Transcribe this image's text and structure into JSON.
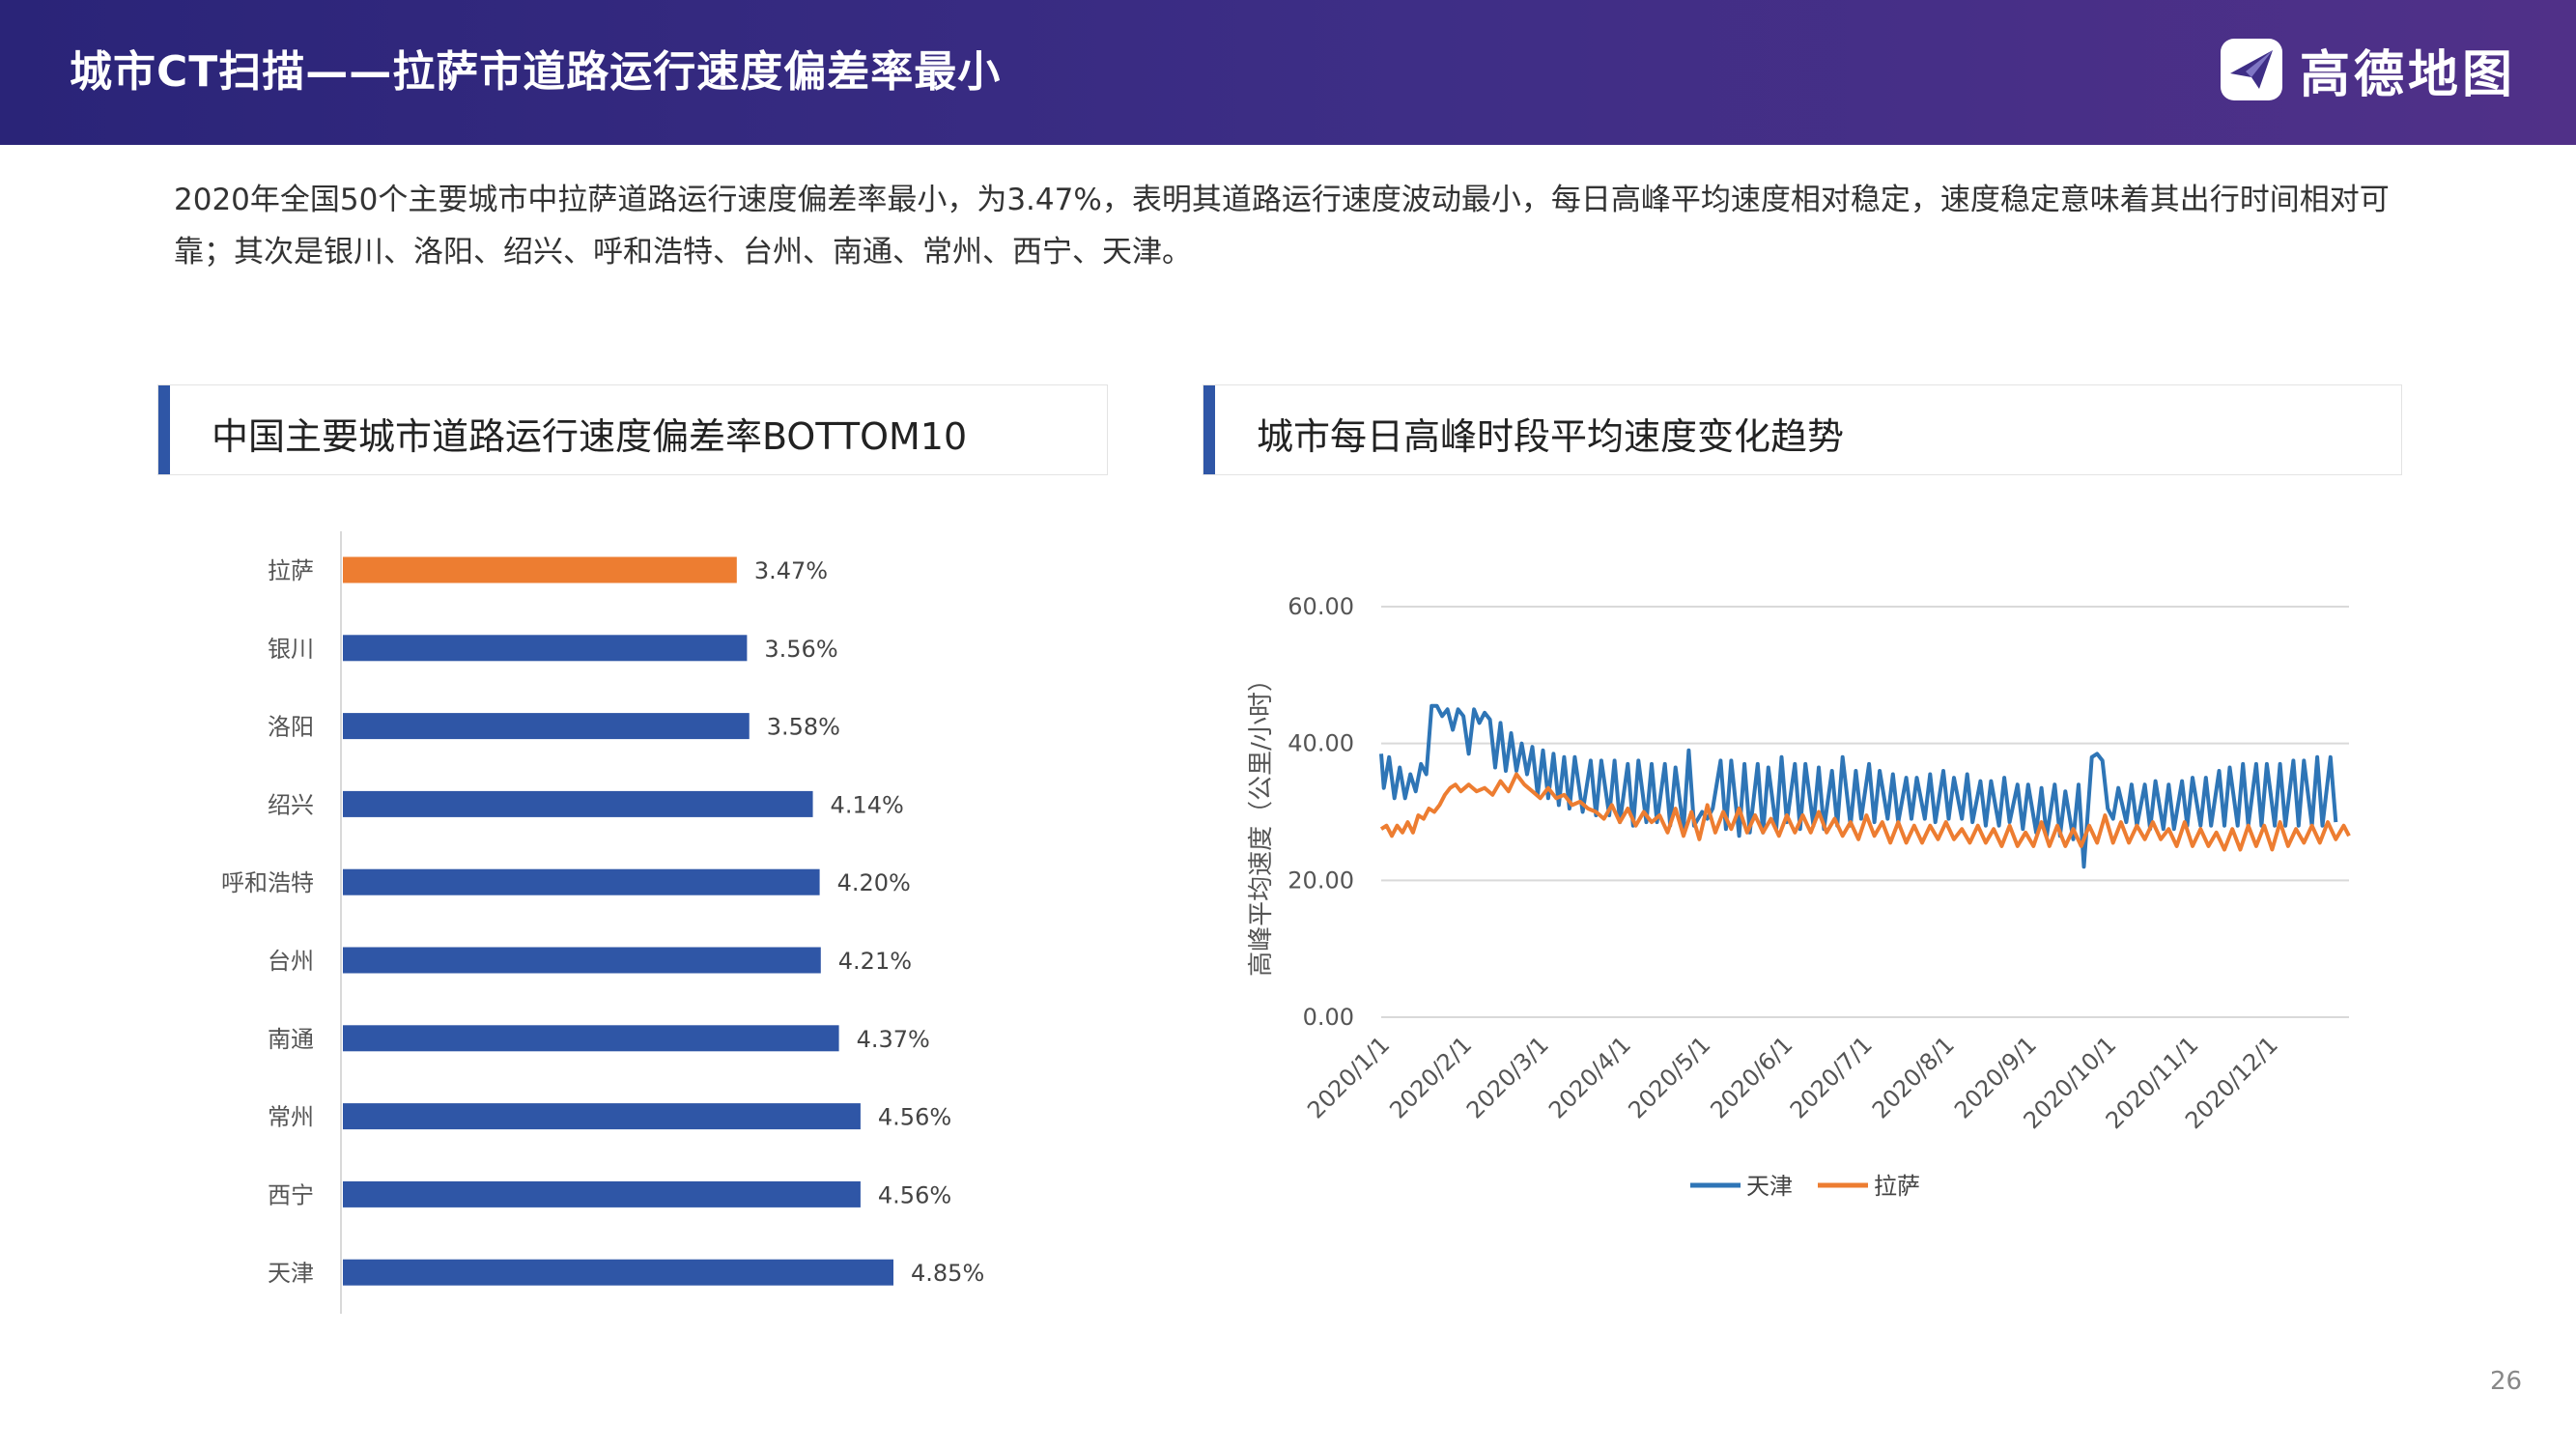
{
  "header": {
    "title": "城市CT扫描——拉萨市道路运行速度偏差率最小",
    "brand": "高德地图",
    "logo_icon": "paper-plane-logo-icon"
  },
  "intro_text": "2020年全国50个主要城市中拉萨道路运行速度偏差率最小，为3.47%，表明其道路运行速度波动最小，每日高峰平均速度相对稳定，速度稳定意味着其出行时间相对可靠；其次是银川、洛阳、绍兴、呼和浩特、台州、南通、常州、西宁、天津。",
  "left_section": {
    "title": "中国主要城市道路运行速度偏差率BOTTOM10"
  },
  "right_section": {
    "title": "城市每日高峰时段平均速度变化趋势"
  },
  "page_number": "26",
  "colors": {
    "header": "#2a2478",
    "accent_blue": "#2f56a6",
    "highlight_orange": "#ed7d31",
    "line_blue": "#2e75b6",
    "line_orange": "#ed7d31"
  },
  "chart_data": [
    {
      "type": "bar",
      "orientation": "horizontal",
      "categories": [
        "拉萨",
        "银川",
        "洛阳",
        "绍兴",
        "呼和浩特",
        "台州",
        "南通",
        "常州",
        "西宁",
        "天津"
      ],
      "values": [
        3.47,
        3.56,
        3.58,
        4.14,
        4.2,
        4.21,
        4.37,
        4.56,
        4.56,
        4.85
      ],
      "value_labels": [
        "3.47%",
        "3.56%",
        "3.58%",
        "4.14%",
        "4.20%",
        "4.21%",
        "4.37%",
        "4.56%",
        "4.56%",
        "4.85%"
      ],
      "highlight_index": 0,
      "bar_color": "#2f56a6",
      "highlight_color": "#ed7d31"
    },
    {
      "type": "line",
      "ylabel": "高峰平均速度（公里/小时）",
      "ylim": [
        0,
        60
      ],
      "yticks": [
        "0.00",
        "20.00",
        "40.00",
        "60.00"
      ],
      "xlim": [
        "2020-01-01",
        "2020-12-31"
      ],
      "xticks": [
        "2020/1/1",
        "2020/2/1",
        "2020/3/1",
        "2020/4/1",
        "2020/5/1",
        "2020/6/1",
        "2020/7/1",
        "2020/8/1",
        "2020/9/1",
        "2020/10/1",
        "2020/11/1",
        "2020/12/1"
      ],
      "grid": true,
      "legend_position": "bottom",
      "series": [
        {
          "name": "天津",
          "color": "#2e75b6",
          "dates": [
            "2020-01-01",
            "2020-01-02",
            "2020-01-04",
            "2020-01-06",
            "2020-01-08",
            "2020-01-10",
            "2020-01-12",
            "2020-01-14",
            "2020-01-16",
            "2020-01-18",
            "2020-01-20",
            "2020-01-22",
            "2020-01-24",
            "2020-01-26",
            "2020-01-28",
            "2020-01-30",
            "2020-02-01",
            "2020-02-03",
            "2020-02-05",
            "2020-02-07",
            "2020-02-09",
            "2020-02-11",
            "2020-02-13",
            "2020-02-15",
            "2020-02-17",
            "2020-02-19",
            "2020-02-21",
            "2020-02-23",
            "2020-02-25",
            "2020-02-27",
            "2020-02-29",
            "2020-03-02",
            "2020-03-04",
            "2020-03-06",
            "2020-03-08",
            "2020-03-10",
            "2020-03-12",
            "2020-03-14",
            "2020-03-17",
            "2020-03-20",
            "2020-03-22",
            "2020-03-24",
            "2020-03-27",
            "2020-03-29",
            "2020-03-31",
            "2020-04-03",
            "2020-04-05",
            "2020-04-07",
            "2020-04-10",
            "2020-04-12",
            "2020-04-14",
            "2020-04-17",
            "2020-04-19",
            "2020-04-21",
            "2020-04-24",
            "2020-04-26",
            "2020-04-28",
            "2020-05-01",
            "2020-05-03",
            "2020-05-05",
            "2020-05-08",
            "2020-05-10",
            "2020-05-12",
            "2020-05-15",
            "2020-05-17",
            "2020-05-19",
            "2020-05-22",
            "2020-05-24",
            "2020-05-26",
            "2020-05-29",
            "2020-05-31",
            "2020-06-02",
            "2020-06-05",
            "2020-06-07",
            "2020-06-09",
            "2020-06-12",
            "2020-06-14",
            "2020-06-16",
            "2020-06-19",
            "2020-06-21",
            "2020-06-23",
            "2020-06-26",
            "2020-06-28",
            "2020-06-30",
            "2020-07-03",
            "2020-07-05",
            "2020-07-07",
            "2020-07-10",
            "2020-07-12",
            "2020-07-14",
            "2020-07-17",
            "2020-07-19",
            "2020-07-21",
            "2020-07-24",
            "2020-07-26",
            "2020-07-28",
            "2020-07-31",
            "2020-08-02",
            "2020-08-04",
            "2020-08-07",
            "2020-08-09",
            "2020-08-11",
            "2020-08-14",
            "2020-08-16",
            "2020-08-18",
            "2020-08-21",
            "2020-08-23",
            "2020-08-25",
            "2020-08-28",
            "2020-08-30",
            "2020-09-01",
            "2020-09-04",
            "2020-09-06",
            "2020-09-08",
            "2020-09-11",
            "2020-09-13",
            "2020-09-15",
            "2020-09-18",
            "2020-09-20",
            "2020-09-22",
            "2020-09-25",
            "2020-09-27",
            "2020-09-29",
            "2020-10-01",
            "2020-10-03",
            "2020-10-05",
            "2020-10-08",
            "2020-10-10",
            "2020-10-12",
            "2020-10-15",
            "2020-10-17",
            "2020-10-19",
            "2020-10-22",
            "2020-10-24",
            "2020-10-26",
            "2020-10-29",
            "2020-10-31",
            "2020-11-02",
            "2020-11-05",
            "2020-11-07",
            "2020-11-09",
            "2020-11-12",
            "2020-11-14",
            "2020-11-16",
            "2020-11-19",
            "2020-11-21",
            "2020-11-23",
            "2020-11-26",
            "2020-11-28",
            "2020-11-30",
            "2020-12-03",
            "2020-12-05",
            "2020-12-07",
            "2020-12-10",
            "2020-12-12",
            "2020-12-14",
            "2020-12-17",
            "2020-12-19",
            "2020-12-21",
            "2020-12-24",
            "2020-12-26",
            "2020-12-28",
            "2020-12-31"
          ],
          "values": [
            38.5,
            33.5,
            38.0,
            32.0,
            36.5,
            32.0,
            35.5,
            33.0,
            37.0,
            35.5,
            45.5,
            45.5,
            44.0,
            45.0,
            42.0,
            45.0,
            44.0,
            38.5,
            45.0,
            43.0,
            44.5,
            43.5,
            36.5,
            43.0,
            36.0,
            41.5,
            36.0,
            40.0,
            35.5,
            39.5,
            32.5,
            39.0,
            32.0,
            38.5,
            31.0,
            38.0,
            30.5,
            38.0,
            30.0,
            37.5,
            29.5,
            37.5,
            29.5,
            37.5,
            28.5,
            37.0,
            28.0,
            37.5,
            28.5,
            37.0,
            28.5,
            37.0,
            28.0,
            36.5,
            27.5,
            39.0,
            28.0,
            30.0,
            29.0,
            30.5,
            37.5,
            27.5,
            37.5,
            26.5,
            37.0,
            27.0,
            37.0,
            27.0,
            36.5,
            27.5,
            38.0,
            28.5,
            37.0,
            27.5,
            37.0,
            28.0,
            36.5,
            27.5,
            36.0,
            28.0,
            38.0,
            28.0,
            36.0,
            29.0,
            37.0,
            28.5,
            36.0,
            29.0,
            35.5,
            28.5,
            35.0,
            29.0,
            35.0,
            29.0,
            35.5,
            28.5,
            36.0,
            29.0,
            35.0,
            29.0,
            35.5,
            28.5,
            34.5,
            28.0,
            34.5,
            28.0,
            35.0,
            28.5,
            34.0,
            27.5,
            34.0,
            27.0,
            33.5,
            26.5,
            34.0,
            26.5,
            33.0,
            26.0,
            34.0,
            22.0,
            38.0,
            38.5,
            37.5,
            30.5,
            29.0,
            33.5,
            28.5,
            34.0,
            28.0,
            34.0,
            27.5,
            34.5,
            27.5,
            34.0,
            27.5,
            34.5,
            28.0,
            35.0,
            28.0,
            35.0,
            28.0,
            36.0,
            28.0,
            36.5,
            28.0,
            37.0,
            28.0,
            37.0,
            28.0,
            37.0,
            28.0,
            37.0,
            28.0,
            37.5,
            28.0,
            37.5,
            28.0,
            38.0,
            28.0,
            38.0,
            28.5
          ]
        },
        {
          "name": "拉萨",
          "color": "#ed7d31",
          "dates": [
            "2020-01-01",
            "2020-01-03",
            "2020-01-05",
            "2020-01-07",
            "2020-01-09",
            "2020-01-11",
            "2020-01-13",
            "2020-01-15",
            "2020-01-17",
            "2020-01-19",
            "2020-01-21",
            "2020-01-23",
            "2020-01-25",
            "2020-01-27",
            "2020-01-29",
            "2020-01-31",
            "2020-02-03",
            "2020-02-06",
            "2020-02-09",
            "2020-02-12",
            "2020-02-15",
            "2020-02-18",
            "2020-02-21",
            "2020-02-24",
            "2020-02-27",
            "2020-03-01",
            "2020-03-04",
            "2020-03-07",
            "2020-03-10",
            "2020-03-13",
            "2020-03-16",
            "2020-03-19",
            "2020-03-22",
            "2020-03-25",
            "2020-03-28",
            "2020-03-31",
            "2020-04-03",
            "2020-04-06",
            "2020-04-09",
            "2020-04-12",
            "2020-04-15",
            "2020-04-18",
            "2020-04-21",
            "2020-04-24",
            "2020-04-27",
            "2020-04-30",
            "2020-05-03",
            "2020-05-06",
            "2020-05-09",
            "2020-05-12",
            "2020-05-15",
            "2020-05-18",
            "2020-05-21",
            "2020-05-24",
            "2020-05-27",
            "2020-05-30",
            "2020-06-02",
            "2020-06-05",
            "2020-06-08",
            "2020-06-11",
            "2020-06-14",
            "2020-06-17",
            "2020-06-20",
            "2020-06-23",
            "2020-06-26",
            "2020-06-29",
            "2020-07-02",
            "2020-07-05",
            "2020-07-08",
            "2020-07-11",
            "2020-07-14",
            "2020-07-17",
            "2020-07-20",
            "2020-07-23",
            "2020-07-26",
            "2020-07-29",
            "2020-08-01",
            "2020-08-04",
            "2020-08-07",
            "2020-08-10",
            "2020-08-13",
            "2020-08-16",
            "2020-08-19",
            "2020-08-22",
            "2020-08-25",
            "2020-08-28",
            "2020-08-31",
            "2020-09-03",
            "2020-09-06",
            "2020-09-09",
            "2020-09-12",
            "2020-09-15",
            "2020-09-18",
            "2020-09-21",
            "2020-09-24",
            "2020-09-27",
            "2020-09-30",
            "2020-10-03",
            "2020-10-06",
            "2020-10-09",
            "2020-10-12",
            "2020-10-15",
            "2020-10-18",
            "2020-10-21",
            "2020-10-24",
            "2020-10-27",
            "2020-10-30",
            "2020-11-02",
            "2020-11-05",
            "2020-11-08",
            "2020-11-11",
            "2020-11-14",
            "2020-11-17",
            "2020-11-20",
            "2020-11-23",
            "2020-11-26",
            "2020-11-29",
            "2020-12-02",
            "2020-12-05",
            "2020-12-08",
            "2020-12-11",
            "2020-12-14",
            "2020-12-17",
            "2020-12-20",
            "2020-12-23",
            "2020-12-26",
            "2020-12-29",
            "2020-12-31"
          ],
          "values": [
            27.5,
            28.0,
            26.5,
            28.0,
            27.0,
            28.5,
            27.0,
            29.5,
            29.0,
            30.5,
            30.0,
            31.0,
            32.5,
            33.5,
            34.0,
            33.0,
            34.0,
            33.0,
            33.5,
            32.5,
            34.5,
            33.0,
            35.5,
            34.0,
            33.0,
            32.0,
            33.5,
            32.0,
            32.5,
            31.0,
            31.5,
            30.5,
            30.0,
            29.0,
            31.0,
            28.5,
            30.5,
            28.0,
            30.0,
            28.5,
            29.5,
            27.0,
            30.5,
            26.5,
            30.0,
            26.0,
            31.0,
            27.0,
            30.0,
            27.5,
            30.5,
            27.0,
            29.5,
            27.0,
            29.0,
            26.5,
            29.5,
            27.0,
            29.5,
            27.0,
            30.0,
            27.0,
            29.0,
            26.5,
            28.5,
            26.0,
            29.5,
            26.5,
            28.5,
            25.5,
            28.5,
            25.5,
            28.0,
            25.5,
            28.0,
            26.0,
            28.5,
            26.0,
            27.5,
            25.5,
            28.0,
            25.5,
            27.5,
            25.0,
            28.0,
            25.0,
            27.0,
            25.0,
            28.5,
            25.0,
            28.0,
            25.0,
            27.5,
            25.0,
            28.0,
            25.5,
            29.5,
            25.5,
            28.5,
            25.5,
            28.0,
            26.0,
            28.5,
            26.0,
            27.5,
            25.0,
            28.5,
            25.0,
            27.5,
            25.0,
            27.0,
            24.5,
            27.5,
            24.5,
            28.0,
            25.0,
            28.0,
            24.5,
            28.5,
            25.0,
            27.5,
            25.5,
            28.0,
            25.5,
            28.5,
            26.0,
            28.0,
            26.5
          ]
        }
      ]
    }
  ]
}
